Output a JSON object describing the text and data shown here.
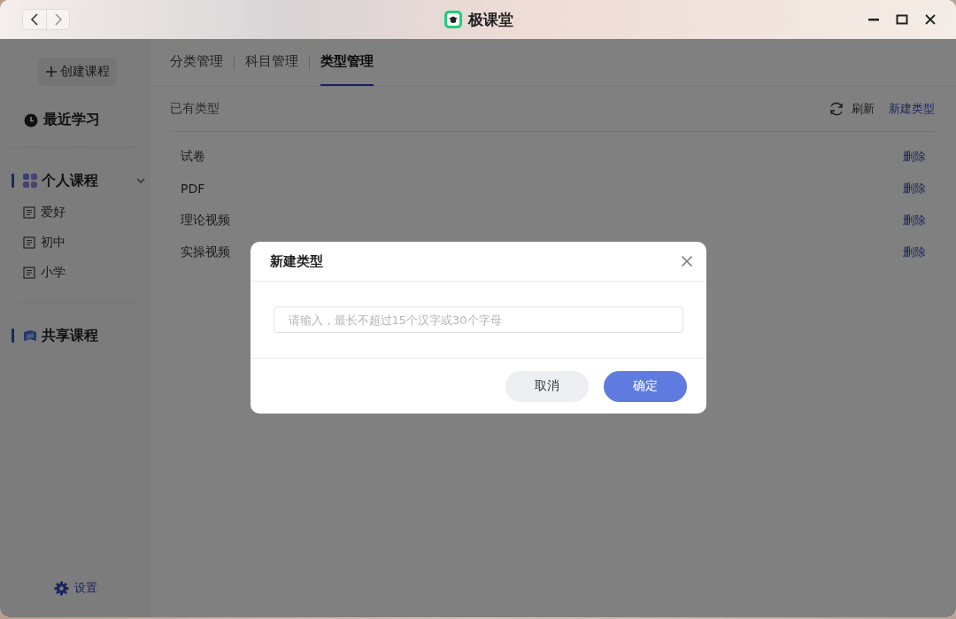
{
  "window": {
    "title": "极课堂"
  },
  "sidebar": {
    "create_button": "创建课程",
    "recent": "最近学习",
    "groups": [
      {
        "label": "个人课程",
        "kind": "personal",
        "expanded": true,
        "children": [
          "爱好",
          "初中",
          "小学"
        ]
      },
      {
        "label": "共享课程",
        "kind": "shared"
      }
    ],
    "settings": "设置"
  },
  "tabs": [
    {
      "label": "分类管理",
      "selected": false
    },
    {
      "label": "科目管理",
      "selected": false
    },
    {
      "label": "类型管理",
      "selected": true
    }
  ],
  "section_title": "已有类型",
  "refresh": "刷新",
  "new_type": "新建类型",
  "rows": [
    {
      "name": "试卷",
      "action": "删除"
    },
    {
      "name": "PDF",
      "action": "删除"
    },
    {
      "name": "理论视频",
      "action": "删除"
    },
    {
      "name": "实操视频",
      "action": "删除"
    }
  ],
  "dialog": {
    "title": "新建类型",
    "placeholder": "请输入，最长不超过15个汉字或30个字母",
    "buttons": [
      {
        "label": "取消",
        "kind": "secondary"
      },
      {
        "label": "确定",
        "kind": "primary"
      }
    ]
  }
}
